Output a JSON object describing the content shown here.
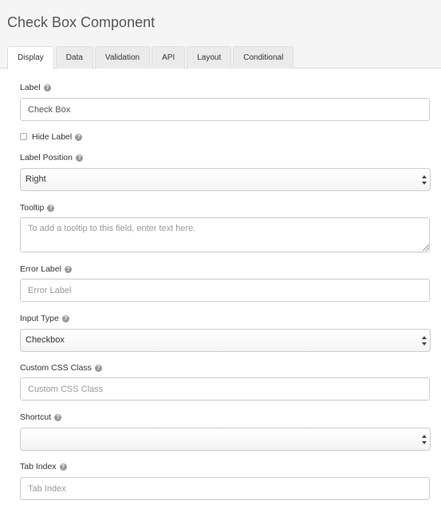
{
  "title": "Check Box Component",
  "tabs": [
    "Display",
    "Data",
    "Validation",
    "API",
    "Layout",
    "Conditional"
  ],
  "active_tab": "Display",
  "help_icon_glyph": "?",
  "fields": {
    "label": {
      "label": "Label",
      "value": "Check Box"
    },
    "hide_label": {
      "label": "Hide Label",
      "checked": false
    },
    "label_position": {
      "label": "Label Position",
      "value": "Right"
    },
    "tooltip": {
      "label": "Tooltip",
      "placeholder": "To add a tooltip to this field, enter text here."
    },
    "error_label": {
      "label": "Error Label",
      "placeholder": "Error Label"
    },
    "input_type": {
      "label": "Input Type",
      "value": "Checkbox"
    },
    "custom_css_class": {
      "label": "Custom CSS Class",
      "placeholder": "Custom CSS Class"
    },
    "shortcut": {
      "label": "Shortcut",
      "value": ""
    },
    "tab_index": {
      "label": "Tab Index",
      "placeholder": "Tab Index"
    }
  },
  "colors": {
    "border": "#cccccc",
    "header_bg": "#f5f5f5",
    "help_icon": "#999999"
  }
}
